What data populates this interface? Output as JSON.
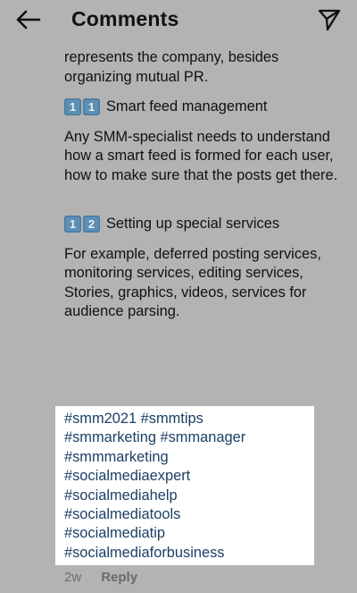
{
  "header": {
    "title": "Comments",
    "back_icon": "arrow-left-icon",
    "send_icon": "send-icon"
  },
  "comment": {
    "intro": "represents the company, besides organizing mutual PR.",
    "section1": {
      "keycaps": [
        "1",
        "1"
      ],
      "heading": "Smart feed management",
      "body": "Any SMM-specialist needs to understand how a smart feed is formed for each user, how to make sure that the posts get there."
    },
    "section2": {
      "keycaps": [
        "1",
        "2"
      ],
      "heading": "Setting up special services",
      "body": "For example, deferred posting services, monitoring services, editing services, Stories, graphics, videos, services for audience parsing."
    },
    "hashtags": [
      "#smm2021",
      "#smmtips",
      "#smmarketing",
      "#smmanager",
      "#smmmarketing",
      "#socialmediaexpert",
      "#socialmediahelp",
      "#socialmediatools",
      "#socialmediatip",
      "#socialmediaforbusiness"
    ],
    "time_ago": "2w",
    "reply_label": "Reply"
  },
  "colors": {
    "background": "#b3b3b3",
    "hashtag_box": "#ffffff",
    "hashtag_text": "#1c3f66",
    "keycap": "#5d8fb4"
  }
}
